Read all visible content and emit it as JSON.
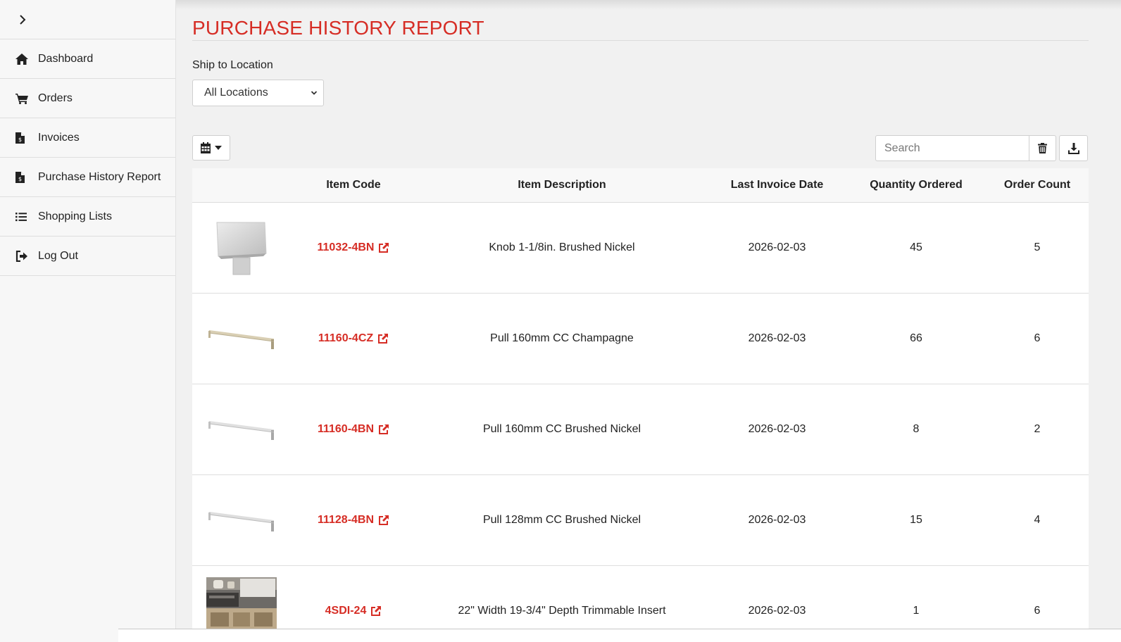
{
  "sidebar": {
    "items": [
      {
        "label": "Dashboard",
        "icon": "home-icon"
      },
      {
        "label": "Orders",
        "icon": "cart-icon"
      },
      {
        "label": "Invoices",
        "icon": "invoice-icon"
      },
      {
        "label": "Purchase History Report",
        "icon": "invoice-icon"
      },
      {
        "label": "Shopping Lists",
        "icon": "list-icon"
      },
      {
        "label": "Log Out",
        "icon": "logout-icon"
      }
    ]
  },
  "page": {
    "title": "PURCHASE HISTORY REPORT",
    "location_label": "Ship to Location",
    "location_value": "All Locations"
  },
  "toolbar": {
    "search_placeholder": "Search"
  },
  "table": {
    "headers": [
      "Item Code",
      "Item Description",
      "Last Invoice Date",
      "Quantity Ordered",
      "Order Count"
    ],
    "rows": [
      {
        "code": "11032-4BN",
        "description": "Knob 1-1/8in. Brushed Nickel",
        "date": "2026-02-03",
        "qty": "45",
        "count": "5"
      },
      {
        "code": "11160-4CZ",
        "description": "Pull 160mm CC Champagne",
        "date": "2026-02-03",
        "qty": "66",
        "count": "6"
      },
      {
        "code": "11160-4BN",
        "description": "Pull 160mm CC Brushed Nickel",
        "date": "2026-02-03",
        "qty": "8",
        "count": "2"
      },
      {
        "code": "11128-4BN",
        "description": "Pull 128mm CC Brushed Nickel",
        "date": "2026-02-03",
        "qty": "15",
        "count": "4"
      },
      {
        "code": "4SDI-24",
        "description": "22\" Width 19-3/4\" Depth Trimmable Insert",
        "date": "2026-02-03",
        "qty": "1",
        "count": "6"
      }
    ]
  },
  "colors": {
    "accent": "#d62d25",
    "background": "#f1f1f1",
    "sidebar": "#f7f7f7"
  }
}
